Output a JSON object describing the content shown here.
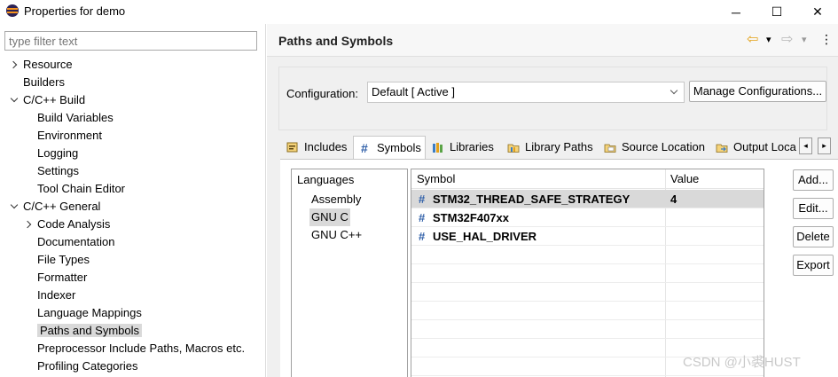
{
  "window": {
    "title": "Properties for demo",
    "minimize": "─",
    "maximize": "☐",
    "close": "✕"
  },
  "filter": {
    "placeholder": "type filter text"
  },
  "tree": [
    {
      "label": "Resource",
      "level": 0,
      "expander": "closed"
    },
    {
      "label": "Builders",
      "level": 0,
      "expander": "none"
    },
    {
      "label": "C/C++ Build",
      "level": 0,
      "expander": "open"
    },
    {
      "label": "Build Variables",
      "level": 1,
      "expander": "none"
    },
    {
      "label": "Environment",
      "level": 1,
      "expander": "none"
    },
    {
      "label": "Logging",
      "level": 1,
      "expander": "none"
    },
    {
      "label": "Settings",
      "level": 1,
      "expander": "none"
    },
    {
      "label": "Tool Chain Editor",
      "level": 1,
      "expander": "none"
    },
    {
      "label": "C/C++ General",
      "level": 0,
      "expander": "open"
    },
    {
      "label": "Code Analysis",
      "level": 1,
      "expander": "closed"
    },
    {
      "label": "Documentation",
      "level": 1,
      "expander": "none"
    },
    {
      "label": "File Types",
      "level": 1,
      "expander": "none"
    },
    {
      "label": "Formatter",
      "level": 1,
      "expander": "none"
    },
    {
      "label": "Indexer",
      "level": 1,
      "expander": "none"
    },
    {
      "label": "Language Mappings",
      "level": 1,
      "expander": "none"
    },
    {
      "label": "Paths and Symbols",
      "level": 1,
      "expander": "none",
      "selected": true
    },
    {
      "label": "Preprocessor Include Paths, Macros etc.",
      "level": 1,
      "expander": "none"
    },
    {
      "label": "Profiling Categories",
      "level": 1,
      "expander": "none"
    }
  ],
  "page": {
    "title": "Paths and Symbols",
    "back_icon": "⇦",
    "forward_icon": "⇨",
    "dropdown_icon": "▾",
    "menu_icon": "⋮"
  },
  "config": {
    "label": "Configuration:",
    "value": "Default  [ Active ]",
    "manage_button": "Manage Configurations..."
  },
  "tabs": [
    {
      "label": "Includes",
      "icon": "includes-icon"
    },
    {
      "label": "Symbols",
      "icon": "hash-icon",
      "active": true
    },
    {
      "label": "Libraries",
      "icon": "libraries-icon"
    },
    {
      "label": "Library Paths",
      "icon": "library-paths-icon"
    },
    {
      "label": "Source Location",
      "icon": "source-location-icon"
    },
    {
      "label": "Output Loca",
      "icon": "output-location-icon"
    }
  ],
  "tab_scroll": {
    "left": "◂",
    "right": "▸"
  },
  "languages": {
    "header": "Languages",
    "items": [
      {
        "label": "Assembly"
      },
      {
        "label": "GNU C",
        "selected": true
      },
      {
        "label": "GNU C++"
      }
    ]
  },
  "symbols_table": {
    "columns": [
      "Symbol",
      "Value"
    ],
    "rows": [
      {
        "symbol": "STM32_THREAD_SAFE_STRATEGY",
        "value": "4",
        "selected": true
      },
      {
        "symbol": "STM32F407xx",
        "value": ""
      },
      {
        "symbol": "USE_HAL_DRIVER",
        "value": ""
      }
    ],
    "row_icon": "#"
  },
  "buttons": {
    "add": "Add...",
    "edit": "Edit...",
    "delete": "Delete",
    "export": "Export"
  },
  "watermark": "CSDN @小裘HUST",
  "colors": {
    "selection": "#d9d9d9",
    "hash_icon": "#2f5fa8",
    "app_icon_orange": "#f7941e",
    "app_icon_navy": "#2c2255"
  }
}
